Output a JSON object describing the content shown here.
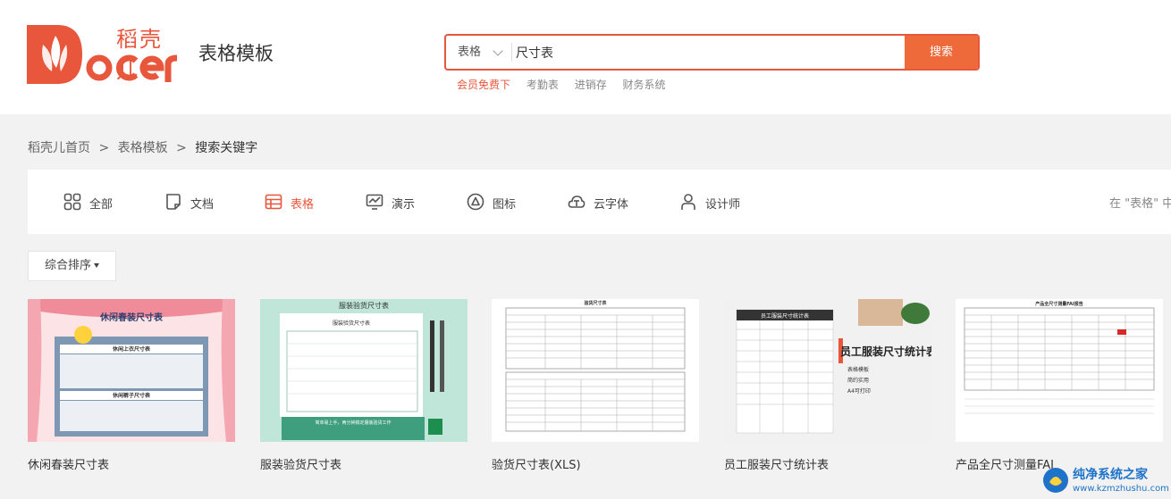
{
  "header": {
    "logo_text": "Docer",
    "logo_brand_cn": "稻壳儿",
    "page_heading": "表格模板",
    "search": {
      "category": "表格",
      "query": "尺寸表",
      "button_label": "搜索"
    },
    "hot_links": [
      "会员免费下",
      "考勤表",
      "进销存",
      "财务系统"
    ]
  },
  "breadcrumb": [
    "稻壳儿首页",
    "表格模板",
    "搜索关键字"
  ],
  "breadcrumb_sep": ">",
  "categories": [
    {
      "label": "全部",
      "icon": "grid-icon"
    },
    {
      "label": "文档",
      "icon": "document-icon"
    },
    {
      "label": "表格",
      "icon": "table-icon",
      "active": true
    },
    {
      "label": "演示",
      "icon": "presentation-icon"
    },
    {
      "label": "图标",
      "icon": "triangle-icon"
    },
    {
      "label": "云字体",
      "icon": "cloud-font-icon"
    },
    {
      "label": "设计师",
      "icon": "user-icon"
    }
  ],
  "filter_hint": "在 \"表格\" 中",
  "sort": {
    "label": "综合排序"
  },
  "templates": [
    {
      "title": "休闲春装尺寸表",
      "thumb_heading": "休闲春装尺寸表",
      "thumb_sub1": "休闲上衣尺寸表",
      "thumb_sub2": "休闲裤子尺寸表"
    },
    {
      "title": "服装验货尺寸表",
      "thumb_heading": "服装验货尺寸表",
      "thumb_sub1": "服装验货尺寸表",
      "thumb_footer": "简单易上手，两分钟搞定服装验货工作"
    },
    {
      "title": "验货尺寸表(XLS)",
      "thumb_heading": "验货尺寸表"
    },
    {
      "title": "员工服装尺寸统计表",
      "thumb_heading": "员工服装尺寸统计表",
      "thumb_sheet_title": "员工服装尺寸统计表",
      "thumb_bullets": [
        "表格模板",
        "简约实用",
        "A4可打印"
      ]
    },
    {
      "title": "产品全尺寸测量FAI",
      "thumb_heading": "产品全尺寸测量FAI报告"
    }
  ],
  "watermark": {
    "line1": "纯净系统之家",
    "line2": "www.kzmzhushu.com"
  },
  "colors": {
    "accent": "#e8573c",
    "search_button": "#ef6a3b",
    "background": "#f2f2f2"
  }
}
